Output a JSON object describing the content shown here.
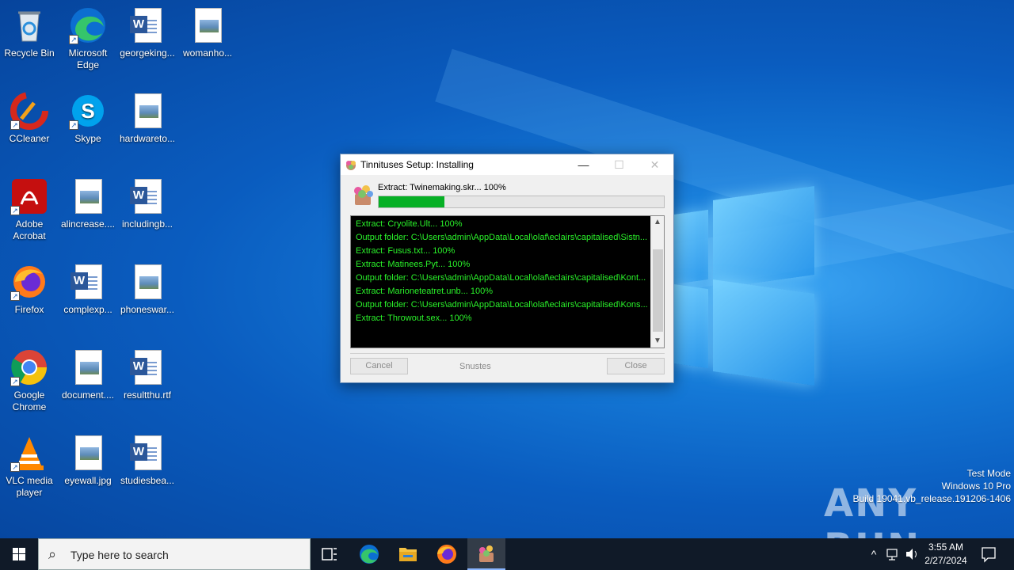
{
  "desktop": {
    "icons": [
      {
        "label": "Recycle Bin",
        "icon": "recycle-bin-icon"
      },
      {
        "label": "Microsoft Edge",
        "icon": "edge-icon"
      },
      {
        "label": "georgeking...",
        "icon": "word-doc-icon"
      },
      {
        "label": "womanho...",
        "icon": "image-file-icon"
      },
      {
        "label": "CCleaner",
        "icon": "ccleaner-icon"
      },
      {
        "label": "Skype",
        "icon": "skype-icon"
      },
      {
        "label": "hardwareto...",
        "icon": "image-file-icon"
      },
      {
        "label": "Adobe Acrobat",
        "icon": "acrobat-icon"
      },
      {
        "label": "alincrease....",
        "icon": "image-file-icon"
      },
      {
        "label": "includingb...",
        "icon": "word-doc-icon"
      },
      {
        "label": "Firefox",
        "icon": "firefox-icon"
      },
      {
        "label": "complexp...",
        "icon": "word-doc-icon"
      },
      {
        "label": "phoneswar...",
        "icon": "image-file-icon"
      },
      {
        "label": "Google Chrome",
        "icon": "chrome-icon"
      },
      {
        "label": "document....",
        "icon": "image-file-icon"
      },
      {
        "label": "resultthu.rtf",
        "icon": "word-doc-icon"
      },
      {
        "label": "VLC media player",
        "icon": "vlc-icon"
      },
      {
        "label": "eyewall.jpg",
        "icon": "image-file-icon"
      },
      {
        "label": "studiesbea...",
        "icon": "word-doc-icon"
      }
    ]
  },
  "installer": {
    "title": "Tinnituses Setup: Installing",
    "status": "Extract: Twinemaking.skr... 100%",
    "progress_fraction": 0.23,
    "log": [
      "Extract: Cryolite.Ult... 100%",
      "Output folder: C:\\Users\\admin\\AppData\\Local\\olaf\\eclairs\\capitalised\\Sistn...",
      "Extract: Fusus.txt... 100%",
      "Extract: Matinees.Pyt... 100%",
      "Output folder: C:\\Users\\admin\\AppData\\Local\\olaf\\eclairs\\capitalised\\Kont...",
      "Extract: Marioneteatret.unb... 100%",
      "Output folder: C:\\Users\\admin\\AppData\\Local\\olaf\\eclairs\\capitalised\\Kons...",
      "Extract: Throwout.sex... 100%"
    ],
    "cancel_label": "Cancel",
    "brand": "Snustes",
    "close_label": "Close",
    "minimize_glyph": "—",
    "maximize_glyph": "☐",
    "close_glyph": "✕"
  },
  "watermark": {
    "line1": "Test Mode",
    "line2": "Windows 10 Pro",
    "line3": "Build 19041.vb_release.191206-1406",
    "anyrun": "ANY RUN"
  },
  "taskbar": {
    "search_placeholder": "Type here to search",
    "time": "3:55 AM",
    "date": "2/27/2024"
  },
  "colors": {
    "progress": "#06b025",
    "log_text": "#2af22a",
    "taskbar": "#101a28"
  }
}
